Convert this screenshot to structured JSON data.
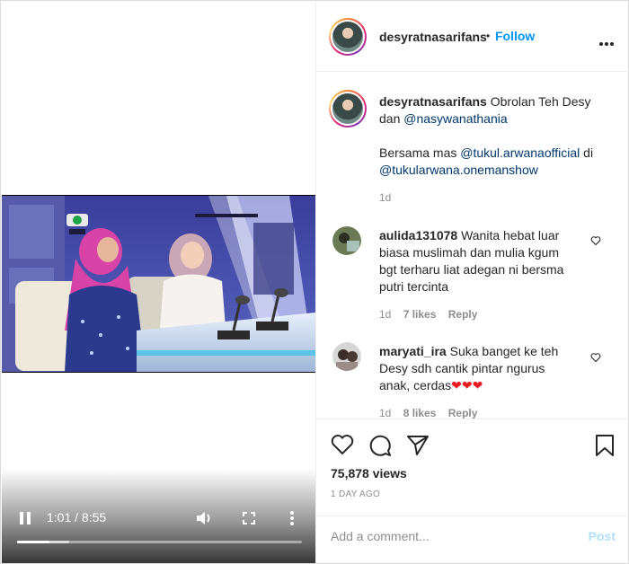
{
  "colors": {
    "accent": "#0095f6",
    "link": "#00376b",
    "muted": "#8e8e8e",
    "post_disabled": "#b2dffc"
  },
  "video": {
    "current_time": "1:01",
    "duration": "8:55",
    "time_display": "1:01 / 8:55",
    "progress_fraction": 0.114,
    "icons": [
      "pause-icon",
      "volume-icon",
      "fullscreen-icon",
      "more-vertical-icon"
    ]
  },
  "header": {
    "username": "desyratnasarifans",
    "separator": "•",
    "follow_label": "Follow",
    "more_icon": "more-horizontal-icon"
  },
  "caption": {
    "username": "desyratnasarifans",
    "text_1": "Obrolan Teh Desy",
    "text_2": "dan",
    "mention_1": "@nasywanathania",
    "text_3": "Bersama mas",
    "mention_2": "@tukul.arwanaofficial",
    "text_4": "di",
    "mention_3": "@tukularwana.onemanshow",
    "time": "1d"
  },
  "comments": [
    {
      "username": "aulida131078",
      "lines": [
        "Wanita hebat luar",
        "biasa muslimah dan mulia kgum",
        "bgt terharu liat adegan ni bersma",
        "putri tercinta"
      ],
      "first_line_text": "Wanita hebat luar",
      "time": "1d",
      "likes": "7 likes",
      "reply": "Reply"
    },
    {
      "username": "maryati_ira",
      "first_line_text": "Suka banget ke teh",
      "lines": [
        "Suka banget ke teh",
        "Desy sdh cantik pintar ngurus",
        "anak, cerdas"
      ],
      "emoji": "❤❤❤",
      "time": "1d",
      "likes": "8 likes",
      "reply": "Reply"
    }
  ],
  "actions": {
    "icons": [
      "heart-icon",
      "comment-icon",
      "share-icon",
      "bookmark-icon"
    ],
    "views": "75,878 views",
    "posted": "1 DAY AGO"
  },
  "add_comment": {
    "placeholder": "Add a comment...",
    "post_label": "Post"
  }
}
